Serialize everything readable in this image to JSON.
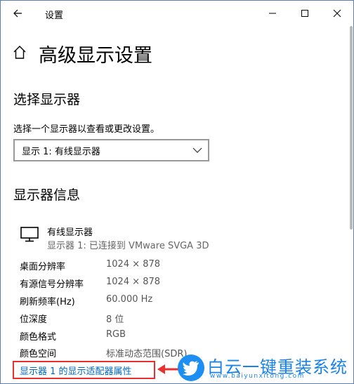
{
  "window": {
    "title": "设置"
  },
  "header": {
    "page_title": "高级显示设置"
  },
  "select_display": {
    "heading": "选择显示器",
    "description": "选择一个显示器以查看或更改设置。",
    "selected": "显示 1: 有线显示器"
  },
  "display_info": {
    "heading": "显示器信息",
    "monitor_name": "有线显示器",
    "monitor_subtitle": "显示器 1: 已连接到 VMware SVGA 3D",
    "rows": [
      {
        "label": "桌面分辨率",
        "value": "1024 × 878"
      },
      {
        "label": "有源信号分辨率",
        "value": "1024 × 878"
      },
      {
        "label": "刷新频率(Hz)",
        "value": "60.000 Hz"
      },
      {
        "label": "位深度",
        "value": "8 位"
      },
      {
        "label": "颜色格式",
        "value": "RGB"
      },
      {
        "label": "颜色空间",
        "value": "标准动态范围(SDR)"
      }
    ],
    "adapter_link": "显示器 1 的显示适配器属性"
  },
  "watermark": {
    "brand": "白云一键重装系统",
    "url": "www.baiyunxitong.com"
  },
  "colors": {
    "link": "#0067c0",
    "highlight_box": "#e8312f",
    "watermark": "#1a83e8"
  }
}
